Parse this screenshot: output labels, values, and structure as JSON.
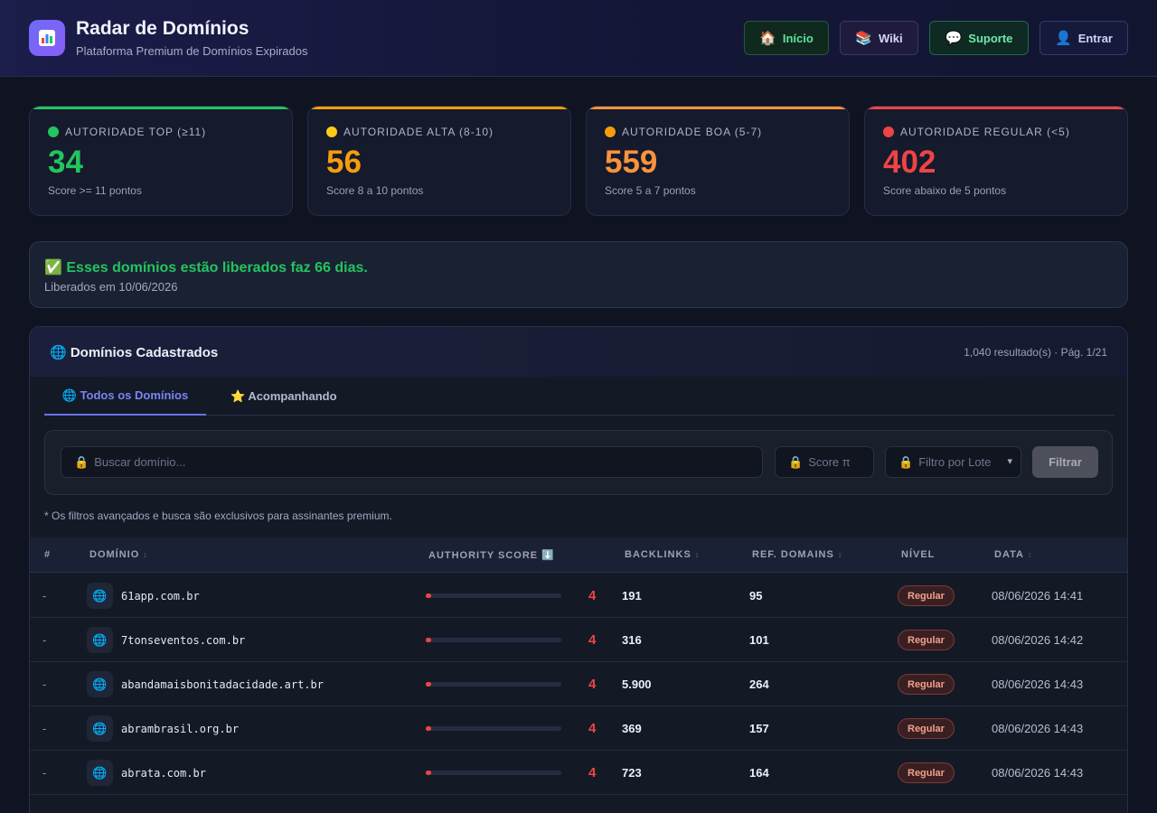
{
  "header": {
    "logo_icon": "chart-icon",
    "title": "Radar de Domínios",
    "subtitle": "Plataforma Premium de Domínios Expirados",
    "nav": [
      {
        "icon": "🏠",
        "label": "Início"
      },
      {
        "icon": "📚",
        "label": "Wiki"
      },
      {
        "icon": "💬",
        "label": "Suporte"
      },
      {
        "icon": "👤",
        "label": "Entrar"
      }
    ]
  },
  "stats": [
    {
      "dot_color": "#22c55e",
      "label": "AUTORIDADE TOP (≥11)",
      "value": "34",
      "desc": "Score >= 11 pontos",
      "color": "#22c55e"
    },
    {
      "dot_color": "#facc15",
      "label": "AUTORIDADE ALTA (8-10)",
      "value": "56",
      "desc": "Score 8 a 10 pontos",
      "color": "#f59e0b"
    },
    {
      "dot_color": "#f59e0b",
      "label": "AUTORIDADE BOA (5-7)",
      "value": "559",
      "desc": "Score 5 a 7 pontos",
      "color": "#fb923c"
    },
    {
      "dot_color": "#ef4444",
      "label": "AUTORIDADE REGULAR (<5)",
      "value": "402",
      "desc": "Score abaixo de 5 pontos",
      "color": "#ef4444"
    }
  ],
  "notice": {
    "title": "✅ Esses domínios estão liberados faz 66 dias.",
    "subtitle": "Liberados em 10/06/2026"
  },
  "panel": {
    "title": "🌐 Domínios Cadastrados",
    "count": "1,040 resultado(s) · Pág. 1/21",
    "tabs": [
      "🌐 Todos os Domínios",
      "⭐ Acompanhando"
    ],
    "filters": {
      "search_placeholder": "Buscar domínio...",
      "score_placeholder": "Score π",
      "lote_selected": "Filtro por Lote",
      "button": "Filtrar",
      "lock_icon": "🔒"
    },
    "note": "* Os filtros avançados e busca são exclusivos para assinantes premium.",
    "columns": [
      "#",
      "DOMÍNIO",
      "AUTHORITY SCORE ⬇️",
      "BACKLINKS",
      "REF. DOMAINS",
      "NÍVEL",
      "DATA"
    ],
    "rows": [
      {
        "idx": "-",
        "domain": "61app.com.br",
        "score": "4",
        "score_fraction": 0.04,
        "backlinks": "191",
        "ref": "95",
        "level": "Regular",
        "date": "08/06/2026 14:41"
      },
      {
        "idx": "-",
        "domain": "7tonseventos.com.br",
        "score": "4",
        "score_fraction": 0.04,
        "backlinks": "316",
        "ref": "101",
        "level": "Regular",
        "date": "08/06/2026 14:42"
      },
      {
        "idx": "-",
        "domain": "abandamaisbonitadacidade.art.br",
        "score": "4",
        "score_fraction": 0.04,
        "backlinks": "5.900",
        "ref": "264",
        "level": "Regular",
        "date": "08/06/2026 14:43"
      },
      {
        "idx": "-",
        "domain": "abrambrasil.org.br",
        "score": "4",
        "score_fraction": 0.04,
        "backlinks": "369",
        "ref": "157",
        "level": "Regular",
        "date": "08/06/2026 14:43"
      },
      {
        "idx": "-",
        "domain": "abrata.com.br",
        "score": "4",
        "score_fraction": 0.04,
        "backlinks": "723",
        "ref": "164",
        "level": "Regular",
        "date": "08/06/2026 14:43"
      }
    ]
  }
}
